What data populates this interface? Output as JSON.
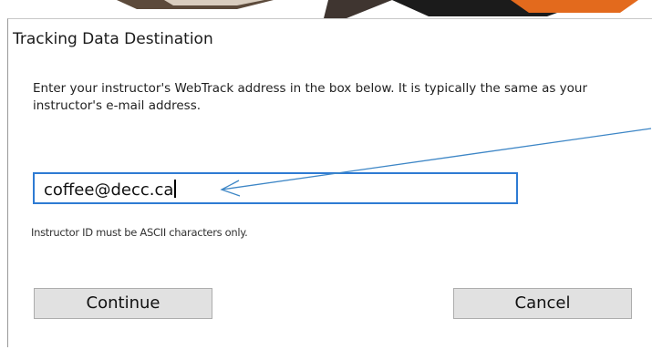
{
  "dialog": {
    "title": "Tracking Data Destination",
    "instructions": "Enter your instructor's WebTrack address in the box below. It is typically the same as your instructor's e-mail address.",
    "address_input": {
      "value": "coffee@decc.ca"
    },
    "hint": "Instructor ID must be ASCII characters only.",
    "continue_label": "Continue",
    "cancel_label": "Cancel"
  },
  "annotation": {
    "arrow_color": "#3d86c6"
  },
  "colors": {
    "focus_border": "#2e7bd3",
    "button_bg": "#e1e1e1"
  }
}
